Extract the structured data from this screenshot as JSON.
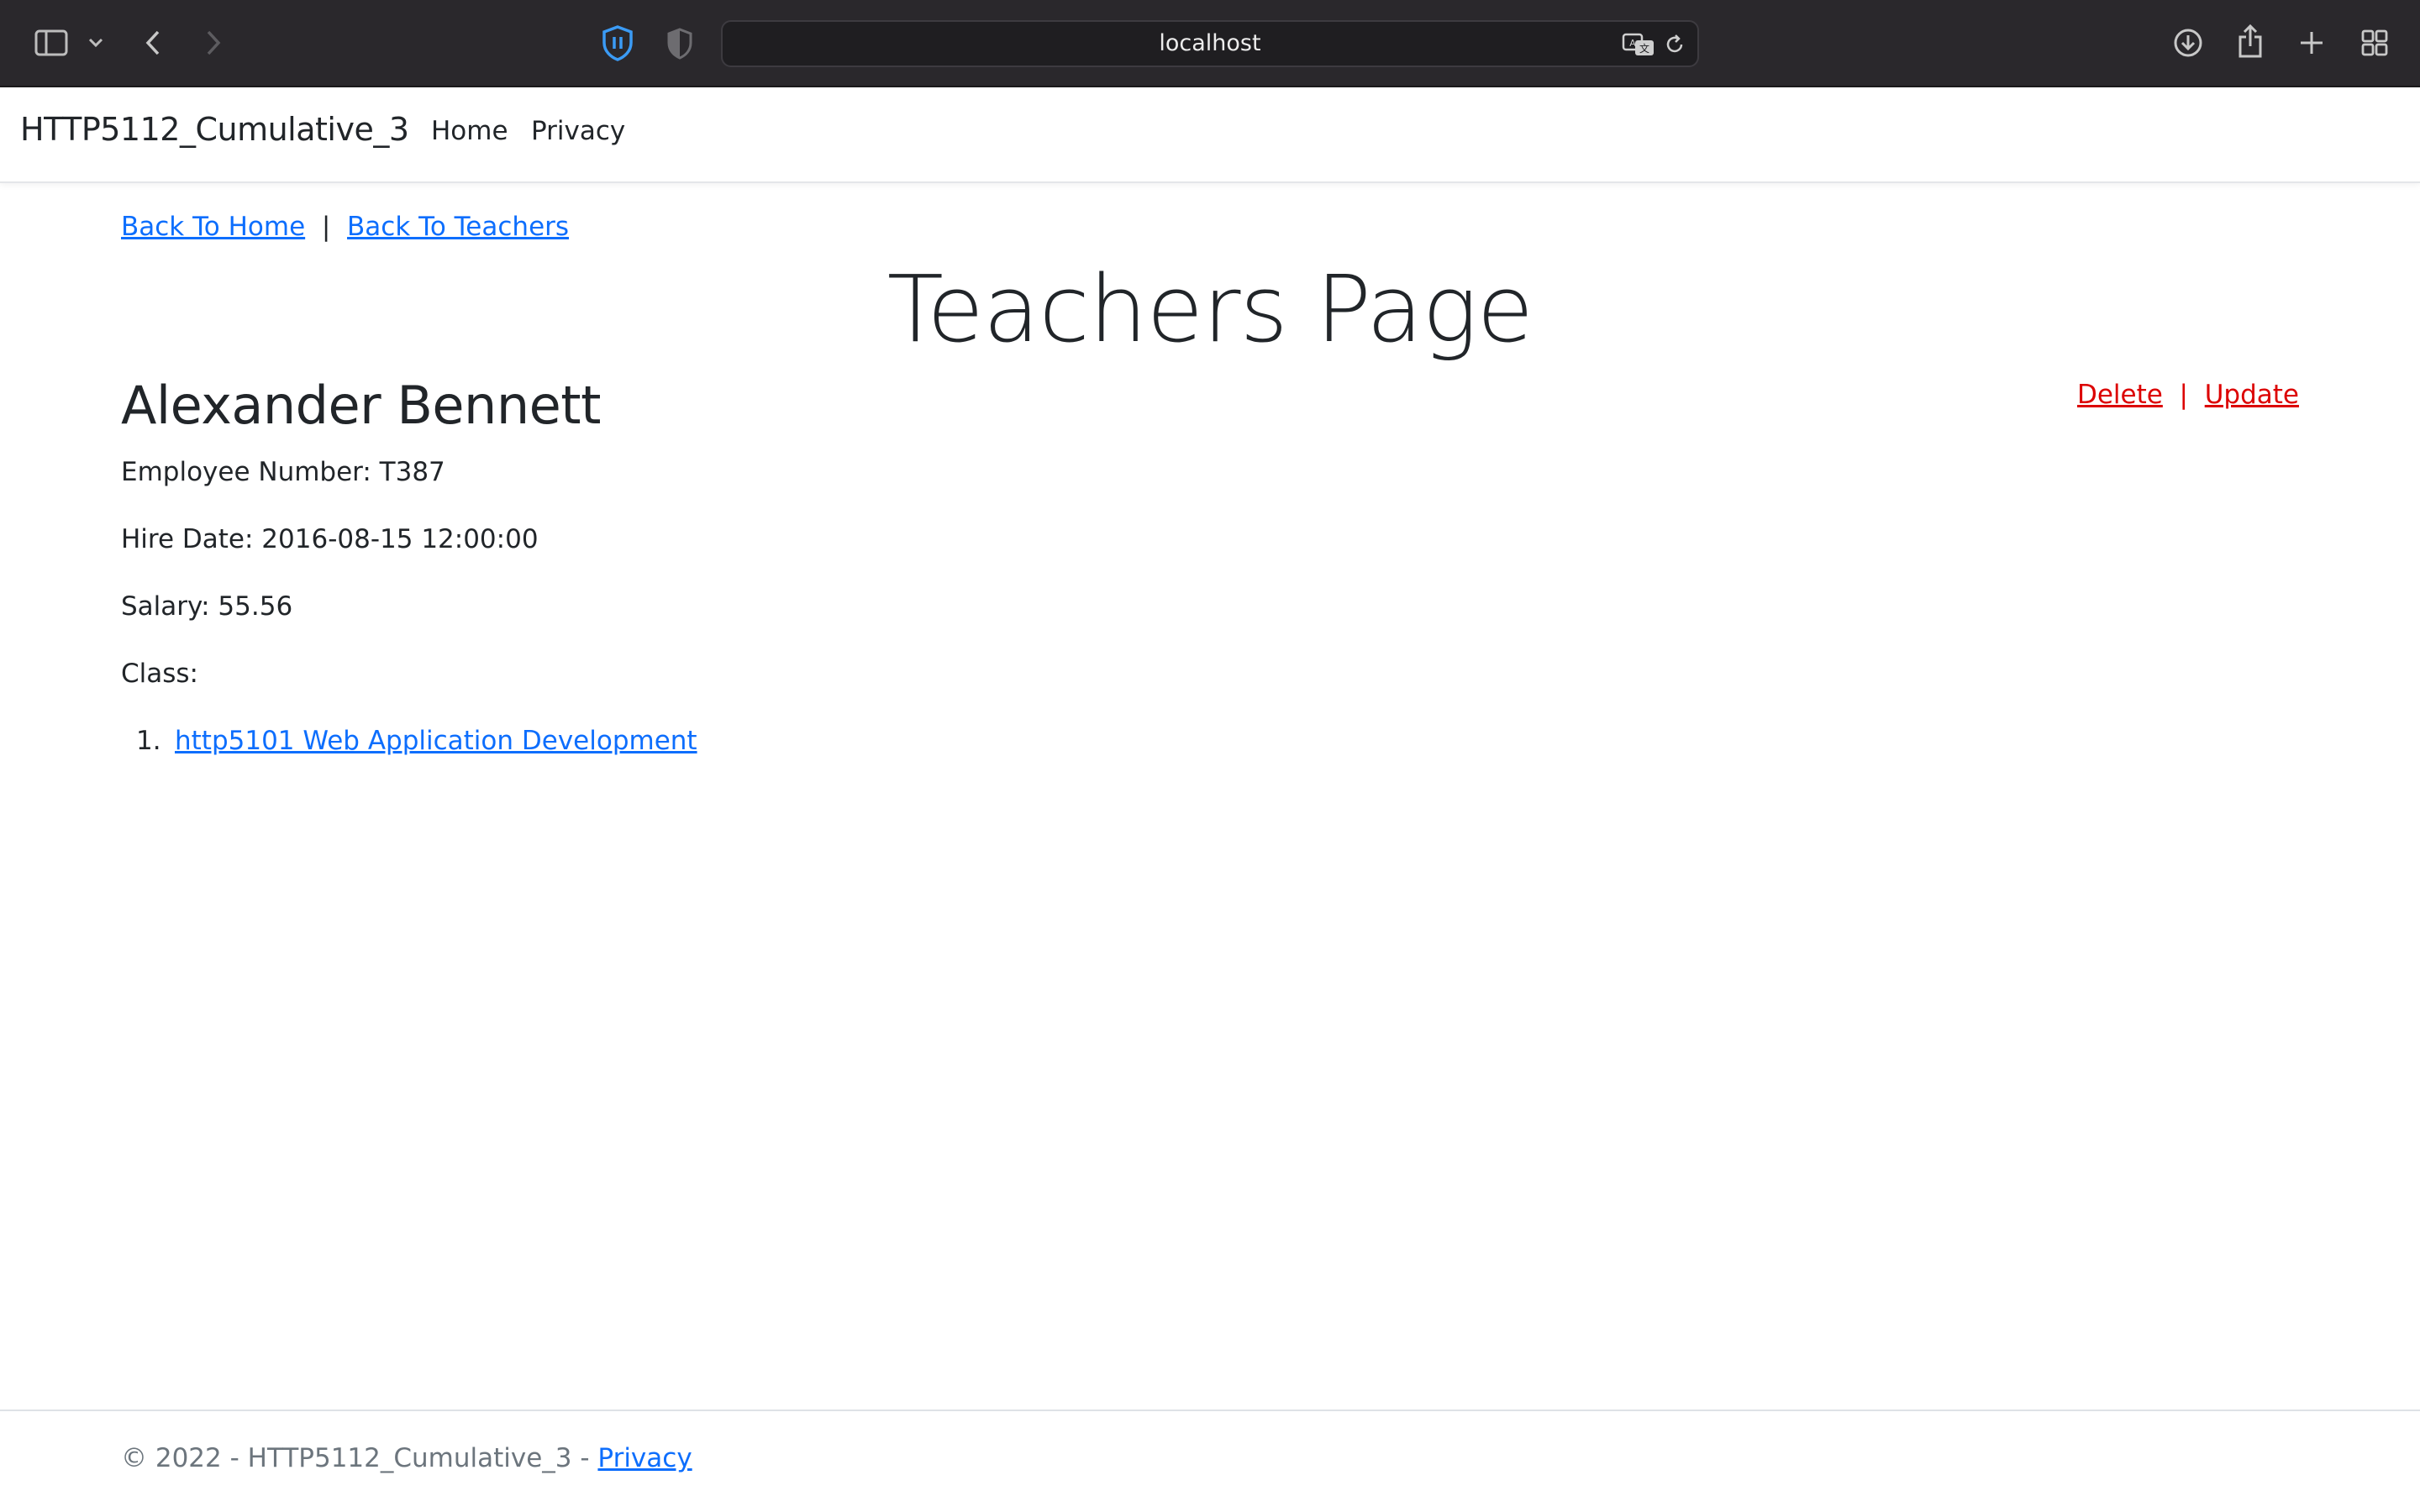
{
  "browser": {
    "url": "localhost"
  },
  "navbar": {
    "brand": "HTTP5112_Cumulative_3",
    "links": [
      "Home",
      "Privacy"
    ]
  },
  "breadcrumb": {
    "home": "Back To Home",
    "separator": "|",
    "teachers": "Back To Teachers"
  },
  "page": {
    "title": "Teachers Page"
  },
  "teacher": {
    "name": "Alexander Bennett",
    "employee_number": "Employee Number: T387",
    "hire_date": "Hire Date: 2016-08-15 12:00:00",
    "salary": "Salary: 55.56",
    "class_label": "Class:",
    "classes": [
      {
        "index": "1.",
        "label": "http5101 Web Application Development"
      }
    ]
  },
  "actions": {
    "delete": "Delete",
    "separator": "|",
    "update": "Update"
  },
  "footer": {
    "text": "© 2022 - HTTP5112_Cumulative_3 - ",
    "privacy": "Privacy"
  },
  "colors": {
    "link": "#0d6efd",
    "danger": "#dc0000",
    "text": "#212529",
    "muted": "#6c757d",
    "chrome": "#2a282c"
  }
}
